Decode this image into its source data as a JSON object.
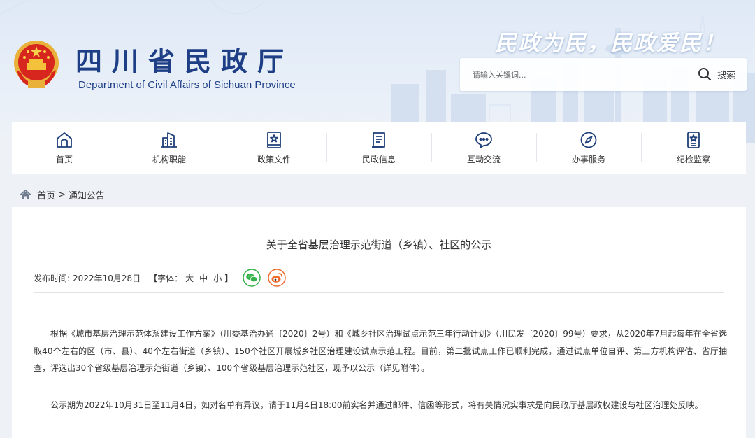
{
  "header": {
    "title": "四川省民政厅",
    "subtitle": "Department of Civil Affairs of Sichuan Province",
    "slogan": "民政为民，民政爱民！"
  },
  "search": {
    "placeholder": "请输入关键词...",
    "button_label": "搜索"
  },
  "nav": {
    "items": [
      {
        "label": "首页",
        "icon": "home-icon"
      },
      {
        "label": "机构职能",
        "icon": "building-icon"
      },
      {
        "label": "政策文件",
        "icon": "policy-book-icon"
      },
      {
        "label": "民政信息",
        "icon": "document-icon"
      },
      {
        "label": "互动交流",
        "icon": "chat-icon"
      },
      {
        "label": "办事服务",
        "icon": "compass-icon"
      },
      {
        "label": "纪检监察",
        "icon": "badge-icon"
      }
    ]
  },
  "breadcrumb": {
    "home": "首页",
    "separator": ">",
    "current": "通知公告"
  },
  "article": {
    "title": "关于全省基层治理示范街道（乡镇）、社区的公示",
    "publish_label": "发布时间:",
    "publish_date": "2022年10月28日",
    "font_label": "【字体：",
    "font_large": "大",
    "font_medium": "中",
    "font_small": "小",
    "font_close": "】",
    "paragraphs": [
      "根据《城市基层治理示范体系建设工作方案》（川委基治办通〔2020〕2号）和《城乡社区治理试点示范三年行动计划》（川民发〔2020〕99号）要求，从2020年7月起每年在全省选取40个左右的区（市、县）、40个左右街道（乡镇）、150个社区开展城乡社区治理建设试点示范工程。目前，第二批试点工作已顺利完成，通过试点单位自评、第三方机构评估、省厅抽查，评选出30个省级基层治理示范街道（乡镇）、100个省级基层治理示范社区，现予以公示（详见附件）。",
      "公示期为2022年10月31日至11月4日，如对名单有异议，请于11月4日18:00前实名并通过邮件、信函等形式，将有关情况实事求是向民政厅基层政权建设与社区治理处反映。"
    ]
  },
  "share": [
    {
      "icon": "wechat-icon",
      "color": "#35b34a"
    },
    {
      "icon": "weibo-icon",
      "color": "#f06a2c"
    }
  ],
  "colors": {
    "brand": "#1e3f86",
    "nav_icon": "#1f3f7a",
    "background": "#eef2f7"
  }
}
